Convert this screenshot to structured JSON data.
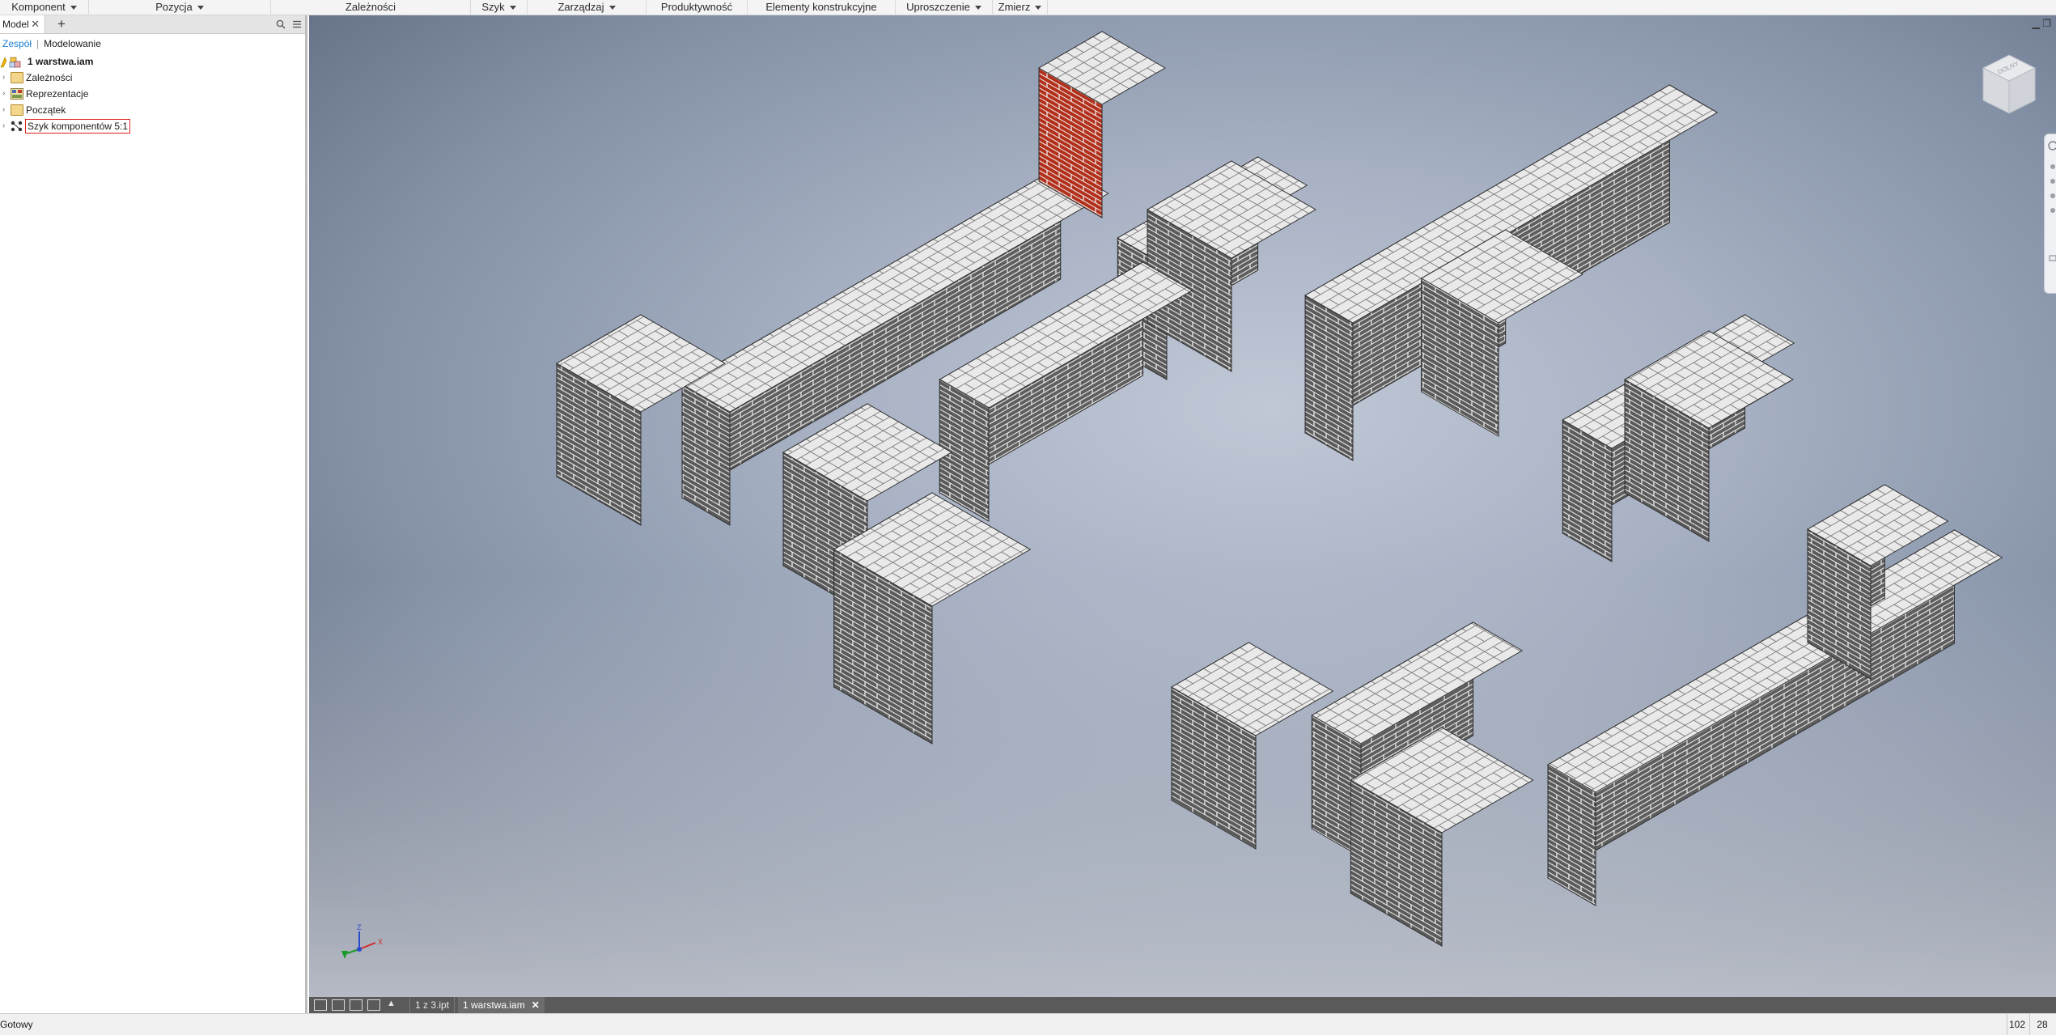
{
  "ribbon": {
    "panels": [
      {
        "label": "Komponent",
        "dropdown": true
      },
      {
        "label": "Pozycja",
        "dropdown": true
      },
      {
        "label": "Zależności",
        "dropdown": false
      },
      {
        "label": "Szyk",
        "dropdown": true
      },
      {
        "label": "Zarządzaj",
        "dropdown": true
      },
      {
        "label": "Produktywność",
        "dropdown": false
      },
      {
        "label": "Elementy konstrukcyjne",
        "dropdown": false
      },
      {
        "label": "Uproszczenie",
        "dropdown": true
      },
      {
        "label": "Zmierz",
        "dropdown": true
      }
    ]
  },
  "browser": {
    "tab_label": "Model",
    "add_tab_symbol": "+",
    "modes": {
      "active": "Zespół",
      "inactive": "Modelowanie"
    },
    "tree": {
      "root": "1 warstwa.iam",
      "items": [
        {
          "label": "Zależności",
          "icon": "folder-icon"
        },
        {
          "label": "Reprezentacje",
          "icon": "representations-icon"
        },
        {
          "label": "Początek",
          "icon": "folder-icon"
        },
        {
          "label": "Szyk komponentów 5:1",
          "icon": "component-pattern-icon"
        }
      ]
    }
  },
  "viewcube": {
    "label": "DOLNY"
  },
  "document_tabs": [
    {
      "label": "1 z 3.ipt",
      "active": false
    },
    {
      "label": "1 warstwa.iam",
      "active": true
    }
  ],
  "status": {
    "text": "Gotowy",
    "n1": "102",
    "n2": "28"
  },
  "colors": {
    "brick_face": "#5e5e5e",
    "brick_top": "#e9e9ea",
    "mortar": "#ffffff",
    "selected_brick": "#b2301b",
    "viewport_center": "#c0c8d6",
    "viewport_edge": "#5f6b80",
    "accent": "#1a7fd4"
  }
}
